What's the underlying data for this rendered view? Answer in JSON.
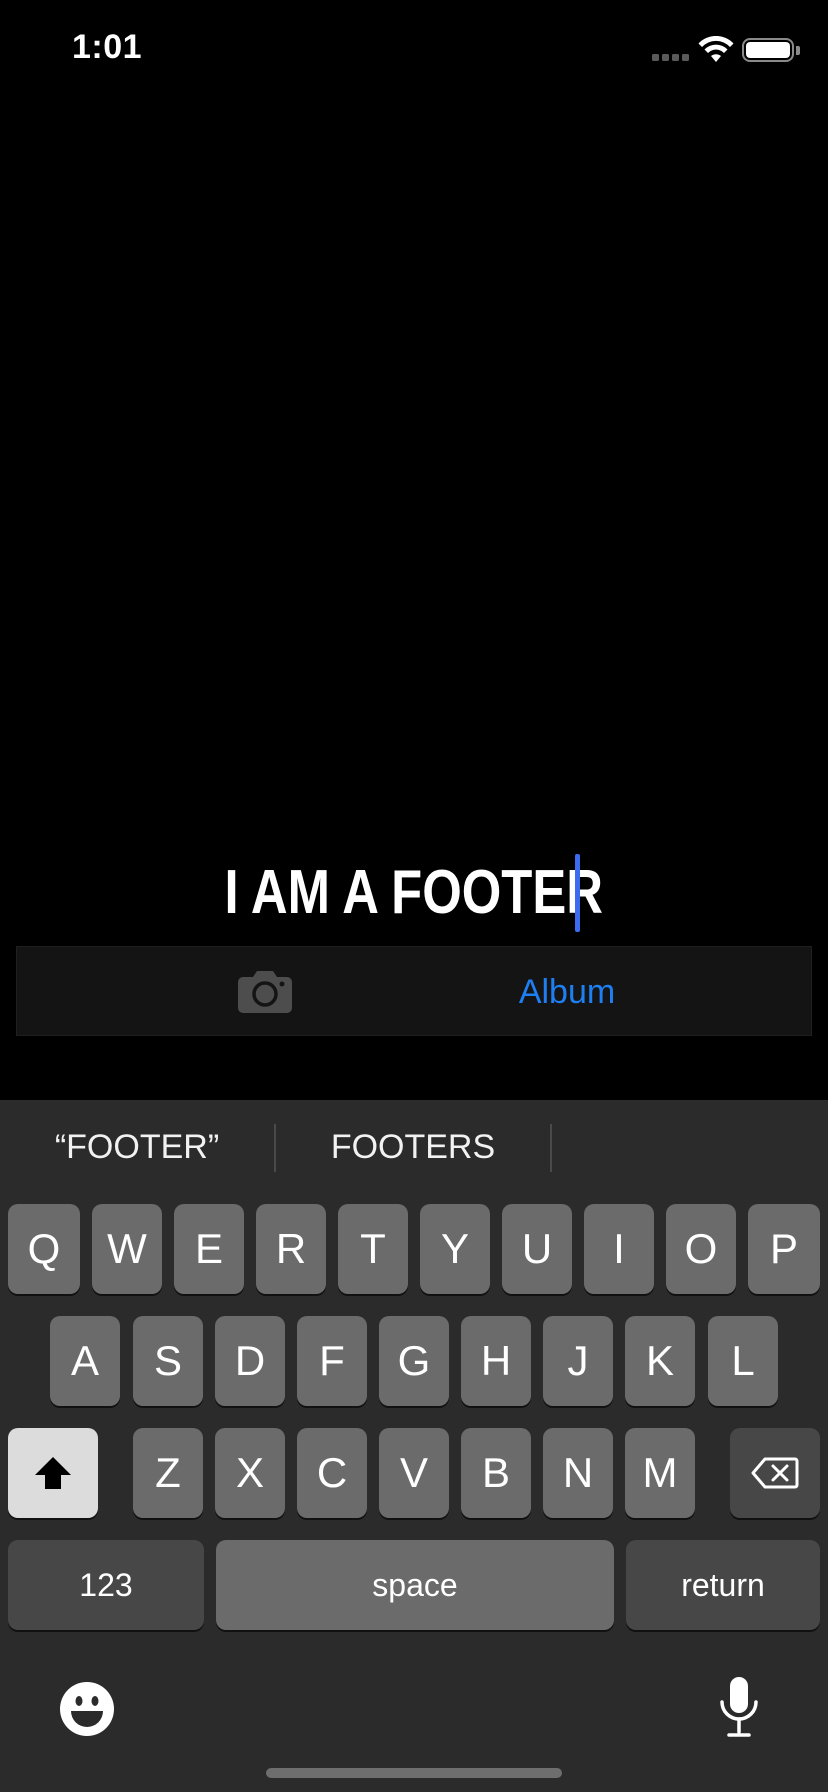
{
  "status_bar": {
    "time": "1:01",
    "icons": [
      "signal-icon",
      "wifi-icon",
      "battery-icon"
    ]
  },
  "caption": {
    "text": "I AM A FOOTER",
    "cursor_color": "#3b6cf0"
  },
  "source_bar": {
    "camera_icon": "camera-icon",
    "album_label": "Album",
    "album_color": "#1e7ff2"
  },
  "keyboard": {
    "suggestions": [
      "“FOOTER”",
      "FOOTERS",
      ""
    ],
    "row1": [
      "Q",
      "W",
      "E",
      "R",
      "T",
      "Y",
      "U",
      "I",
      "O",
      "P"
    ],
    "row2": [
      "A",
      "S",
      "D",
      "F",
      "G",
      "H",
      "J",
      "K",
      "L"
    ],
    "row3": [
      "Z",
      "X",
      "C",
      "V",
      "B",
      "N",
      "M"
    ],
    "shift_icon": "shift-icon",
    "delete_icon": "delete-icon",
    "numbers_label": "123",
    "space_label": "space",
    "return_label": "return",
    "emoji_icon": "emoji-icon",
    "mic_icon": "microphone-icon"
  }
}
